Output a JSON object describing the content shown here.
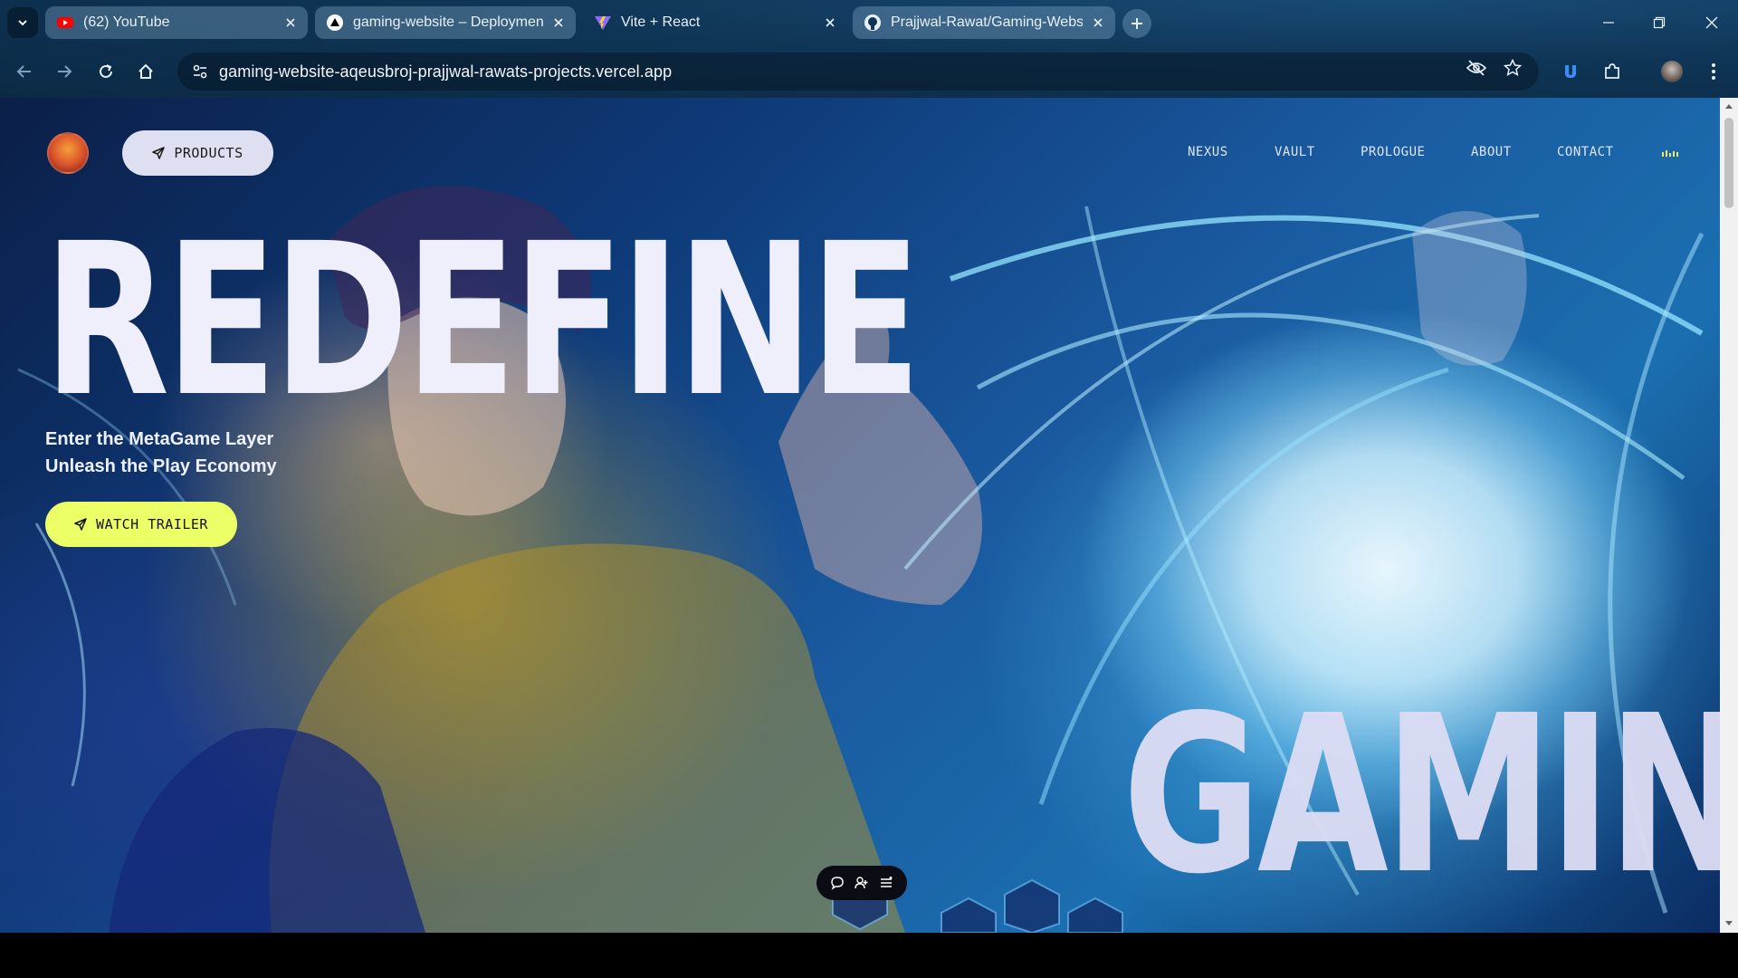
{
  "browser": {
    "tabs": [
      {
        "title": "(62) YouTube",
        "favicon": "youtube-icon",
        "active": false
      },
      {
        "title": "gaming-website – Deployment",
        "favicon": "vercel-icon",
        "active": false
      },
      {
        "title": "Vite + React",
        "favicon": "vite-icon",
        "active": true
      },
      {
        "title": "Prajjwal-Rawat/Gaming-Website",
        "favicon": "github-icon",
        "active": false
      }
    ],
    "url": "gaming-website-aqeusbroj-prajjwal-rawats-projects.vercel.app"
  },
  "page": {
    "products_label": "PRODUCTS",
    "nav": [
      "NEXUS",
      "VAULT",
      "PROLOGUE",
      "ABOUT",
      "CONTACT"
    ],
    "hero_title": "REDEFINE",
    "hero_sub_1": "Enter the MetaGame Layer",
    "hero_sub_2": "Unleash the Play Economy",
    "trailer_label": "WATCH TRAILER",
    "hero_word": "GAMING"
  },
  "colors": {
    "accent_yellow": "#edff66",
    "pill_light": "#dfdff2",
    "hero_text": "#eeeffb"
  }
}
